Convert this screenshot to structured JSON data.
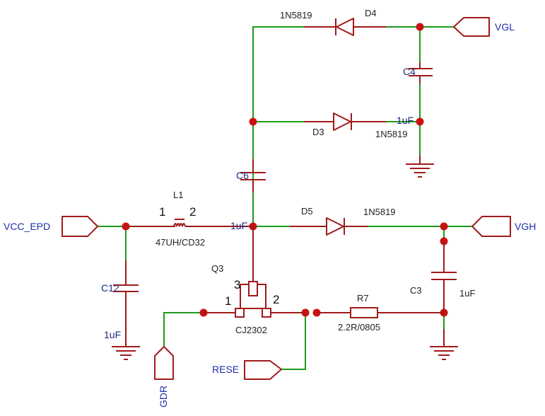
{
  "colors": {
    "wire": "#1e9a1e",
    "component": "#a11a1a",
    "junction": "#cc1111",
    "net_label": "#1f2fb0",
    "ref_label": "#1a2a7a",
    "value_label": "#222222"
  },
  "components": {
    "D4": {
      "ref": "D4",
      "value": "1N5819"
    },
    "D3": {
      "ref": "D3",
      "value": "1N5819"
    },
    "D5": {
      "ref": "D5",
      "value": "1N5819"
    },
    "C4": {
      "ref": "C4",
      "value": "1uF"
    },
    "C6": {
      "ref": "C6",
      "value": "1uF"
    },
    "C12": {
      "ref": "C12",
      "value": "1uF"
    },
    "C3": {
      "ref": "C3",
      "value": "1uF"
    },
    "L1": {
      "ref": "L1",
      "value": "47UH/CD32",
      "pin1": "1",
      "pin2": "2"
    },
    "Q3": {
      "ref": "Q3",
      "value": "CJ2302",
      "pin1": "1",
      "pin2": "2",
      "pin3": "3"
    },
    "R7": {
      "ref": "R7",
      "value": "2.2R/0805"
    }
  },
  "nets": {
    "vgl": "VGL",
    "vgh": "VGH",
    "vcc_epd": "VCC_EPD",
    "rese": "RESE",
    "gdr": "GDR"
  }
}
